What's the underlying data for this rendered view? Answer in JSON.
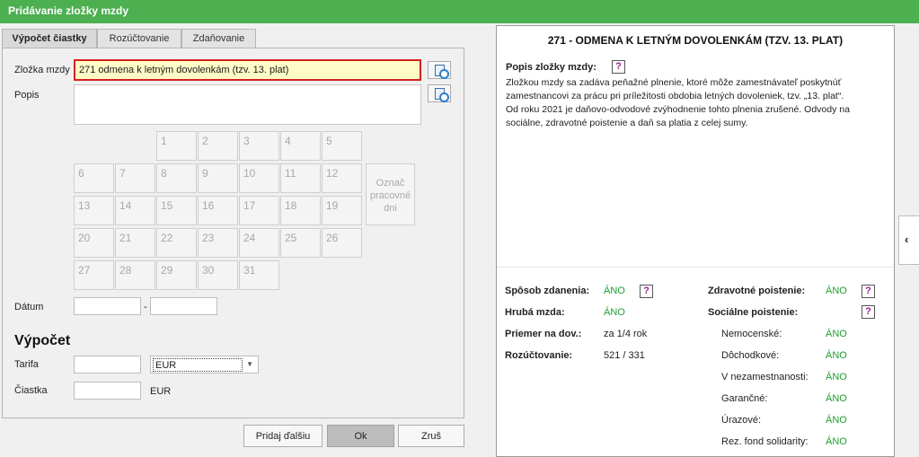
{
  "window": {
    "title": "Pridávanie zložky mzdy"
  },
  "tabs": [
    {
      "label": "Výpočet čiastky",
      "active": true
    },
    {
      "label": "Rozúčtovanie",
      "active": false
    },
    {
      "label": "Zdaňovanie",
      "active": false
    }
  ],
  "form": {
    "zlozka_label": "Zložka mzdy",
    "zlozka_value": "271  odmena k letným dovolenkám (tzv. 13. plat)",
    "popis_label": "Popis",
    "popis_value": "",
    "days": [
      "1",
      "2",
      "3",
      "4",
      "5",
      "6",
      "7",
      "8",
      "9",
      "10",
      "11",
      "12",
      "13",
      "14",
      "15",
      "16",
      "17",
      "18",
      "19",
      "20",
      "21",
      "22",
      "23",
      "24",
      "25",
      "26",
      "27",
      "28",
      "29",
      "30",
      "31"
    ],
    "mark_days_label": "Označ pracovné dni",
    "datum_label": "Dátum",
    "datum_from": "",
    "datum_sep": "-",
    "datum_to": "",
    "vypocet_title": "Výpočet",
    "tarifa_label": "Tarifa",
    "tarifa_value": "",
    "currency_select": "EUR",
    "ciastka_label": "Čiastka",
    "ciastka_value": "",
    "ciastka_unit": "EUR"
  },
  "buttons": {
    "add_next": "Pridaj ďalšiu",
    "ok": "Ok",
    "cancel": "Zruš"
  },
  "info": {
    "title": "271 - ODMENA K LETNÝM DOVOLENKÁM (TZV. 13. PLAT)",
    "popis_label": "Popis zložky mzdy:",
    "description_lines": [
      "Zložkou mzdy sa zadáva peňažné plnenie, ktoré môže zamestnávateľ poskytnúť",
      "zamestnancovi za prácu pri príležitosti obdobia letných dovoleniek, tzv. „13. plat“.",
      "Od roku 2021 je daňovo-odvodové zvýhodnenie tohto plnenia zrušené. Odvody na",
      "sociálne, zdravotné poistenie a daň sa platia z celej sumy."
    ],
    "left_rows": [
      {
        "label": "Spôsob zdanenia:",
        "value": "ÁNO",
        "green": true,
        "help": true
      },
      {
        "label": "Hrubá mzda:",
        "value": "ÁNO",
        "green": true,
        "help": false
      },
      {
        "label": "Priemer na dov.:",
        "value": "za 1/4 rok",
        "green": false,
        "help": false
      },
      {
        "label": "Rozúčtovanie:",
        "value": "521 / 331",
        "green": false,
        "help": false
      }
    ],
    "zdravotne_label": "Zdravotné poistenie:",
    "zdravotne_value": "ÁNO",
    "socialne_label": "Sociálne poistenie:",
    "social_rows": [
      {
        "label": "Nemocenské:",
        "value": "ÁNO"
      },
      {
        "label": "Dôchodkové:",
        "value": "ÁNO"
      },
      {
        "label": "V nezamestnanosti:",
        "value": "ÁNO"
      },
      {
        "label": "Garančné:",
        "value": "ÁNO"
      },
      {
        "label": "Úrazové:",
        "value": "ÁNO"
      },
      {
        "label": "Rez. fond solidarity:",
        "value": "ÁNO"
      }
    ],
    "help_glyph": "?",
    "collapse_glyph": "‹"
  },
  "colors": {
    "titlebar": "#4caf50",
    "highlight_border": "#d32020",
    "highlight_fill": "#fffbc7",
    "yes_green": "#1d9e2f"
  }
}
